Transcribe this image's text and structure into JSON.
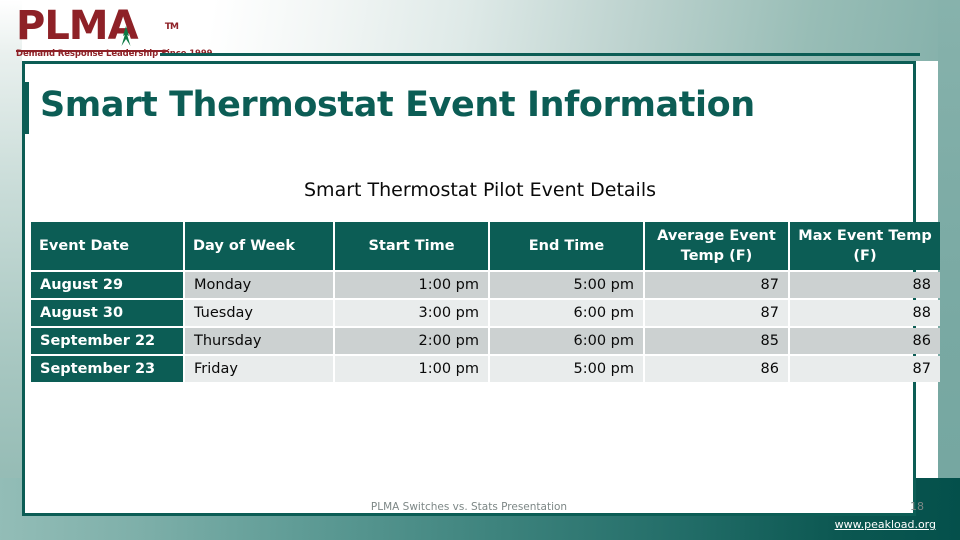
{
  "brand": {
    "logo_word": "PLMA",
    "logo_tm": "TM",
    "logo_tagline": "Demand Response Leadership Since 1999",
    "logo_red": "#8e2127",
    "logo_accent_green": "#0c7a44"
  },
  "theme": {
    "teal": "#0c5d55",
    "sage": "#8cb6af",
    "row_dark": "#ccd1d1",
    "row_light": "#e9ecec",
    "text": "#0a0a0a",
    "footer_text": "#7d8786"
  },
  "slide": {
    "title": "Smart Thermostat Event Information",
    "subtitle": "Smart Thermostat Pilot Event Details"
  },
  "table": {
    "headers": [
      "Event Date",
      "Day of Week",
      "Start Time",
      "End Time",
      "Average Event Temp (F)",
      "Max Event Temp (F)"
    ],
    "rows": [
      {
        "event_date": "August 29",
        "day_of_week": "Monday",
        "start_time": "1:00 pm",
        "end_time": "5:00 pm",
        "avg_temp": "87",
        "max_temp": "88"
      },
      {
        "event_date": "August 30",
        "day_of_week": "Tuesday",
        "start_time": "3:00 pm",
        "end_time": "6:00 pm",
        "avg_temp": "87",
        "max_temp": "88"
      },
      {
        "event_date": "September 22",
        "day_of_week": "Thursday",
        "start_time": "2:00 pm",
        "end_time": "6:00 pm",
        "avg_temp": "85",
        "max_temp": "86"
      },
      {
        "event_date": "September 23",
        "day_of_week": "Friday",
        "start_time": "1:00 pm",
        "end_time": "5:00 pm",
        "avg_temp": "86",
        "max_temp": "87"
      }
    ]
  },
  "footer": {
    "note": "PLMA Switches vs. Stats Presentation",
    "page_number": "18",
    "url": "www.peakload.org"
  }
}
